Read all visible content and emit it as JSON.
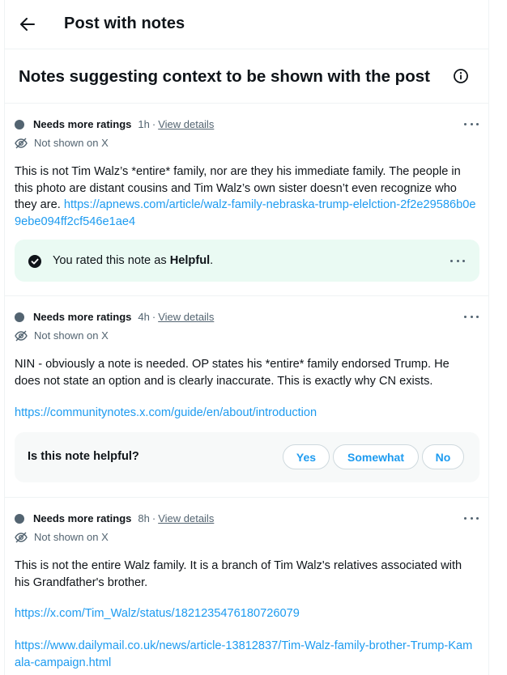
{
  "header": {
    "title": "Post with notes"
  },
  "section": {
    "title": "Notes suggesting context to be shown with the post"
  },
  "notes": [
    {
      "status": "Needs more ratings",
      "time": "1h",
      "separator": "·",
      "view_details": "View details",
      "visibility": "Not shown on X",
      "text": "This is not Tim Walz’s *entire* family, nor are they his immediate family. The people in this photo are distant cousins and Tim Walz’s own sister doesn’t even recognize who they are. ",
      "link": "https://apnews.com/article/walz-family-nebraska-trump-elelction-2f2e29586b0e9ebe094ff2cf546e1ae4",
      "rating": {
        "prefix": "You rated this note as ",
        "value": "Helpful",
        "suffix": "."
      }
    },
    {
      "status": "Needs more ratings",
      "time": "4h",
      "separator": "·",
      "view_details": "View details",
      "visibility": "Not shown on X",
      "text": "NIN - obviously a note is needed. OP states his *entire* family endorsed Trump. He does not state an option and is clearly inaccurate. This is exactly why CN exists.",
      "link": "https://communitynotes.x.com/guide/en/about/introduction",
      "prompt": {
        "question": "Is this note helpful?",
        "yes": "Yes",
        "somewhat": "Somewhat",
        "no": "No"
      }
    },
    {
      "status": "Needs more ratings",
      "time": "8h",
      "separator": "·",
      "view_details": "View details",
      "visibility": "Not shown on X",
      "text": "This is not the entire Walz family. It is a branch of Tim Walz's relatives associated with his Grandfather's brother.",
      "link1": "https://x.com/Tim_Walz/status/1821235476180726079",
      "link2": "https://www.dailymail.co.uk/news/article-13812837/Tim-Walz-family-brother-Trump-Kamala-campaign.html"
    }
  ],
  "colors": {
    "accent": "#1d9bf0",
    "rated_bg": "#eafaf3",
    "prompt_bg": "#f7f9f9",
    "muted": "#536471"
  }
}
